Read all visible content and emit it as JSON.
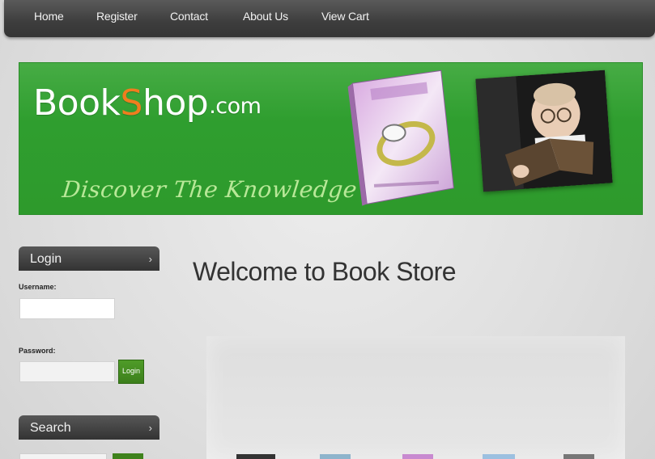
{
  "nav": {
    "items": [
      {
        "label": "Home"
      },
      {
        "label": "Register"
      },
      {
        "label": "Contact"
      },
      {
        "label": "About Us"
      },
      {
        "label": "View Cart"
      }
    ]
  },
  "banner": {
    "logo_pre": "Book",
    "logo_s": "S",
    "logo_post": "hop",
    "logo_domain": ".com",
    "tagline": "Discover The Knowledge"
  },
  "login": {
    "header": "Login",
    "username_label": "Username:",
    "password_label": "Password:",
    "button_label": "Login"
  },
  "search": {
    "header": "Search"
  },
  "main": {
    "welcome": "Welcome to Book Store"
  },
  "colors": {
    "banner_green": "#2f9e2f",
    "accent_orange": "#f07d1e",
    "button_green": "#3c7f1c",
    "nav_dark": "#3d3d3d"
  },
  "icons": {
    "login_arrow": "chevron-right-icon",
    "search_arrow": "chevron-right-icon"
  }
}
